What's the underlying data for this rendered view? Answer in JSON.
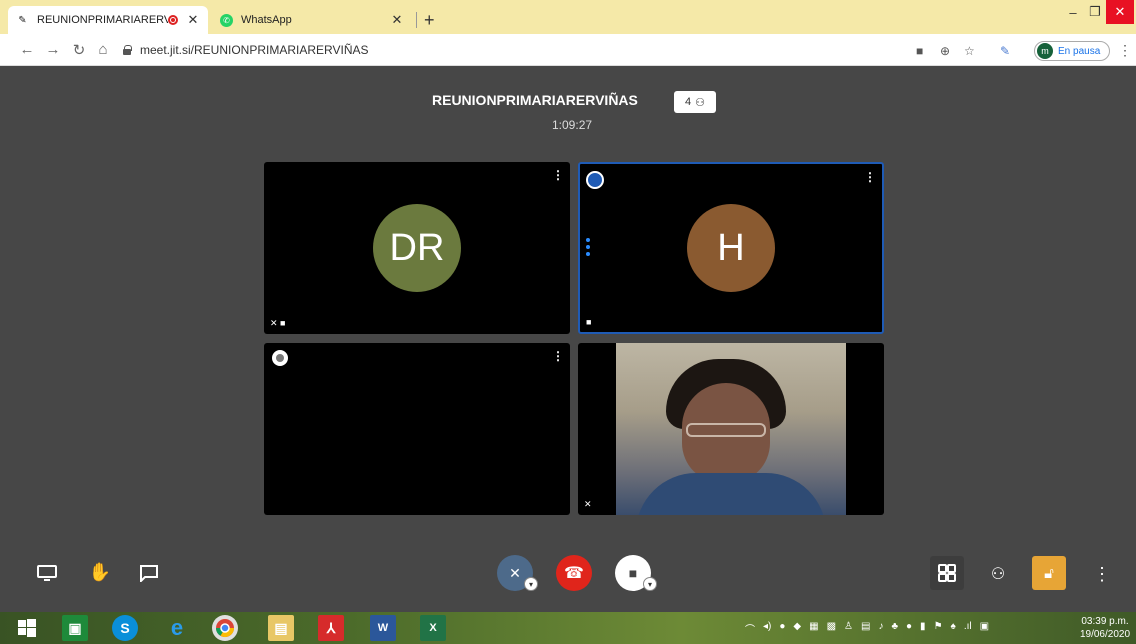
{
  "browser": {
    "tabs": [
      {
        "title": "REUNIONPRIMARIARERVIÑ/"
      },
      {
        "title": "WhatsApp"
      }
    ],
    "url": "meet.jit.si/REUNIONPRIMARIARERVIÑAS",
    "profile_initial": "m",
    "profile_status": "En pausa"
  },
  "meeting": {
    "title": "REUNIONPRIMARIARERVIÑAS",
    "participant_count": "4",
    "elapsed": "1:09:27"
  },
  "tiles": [
    {
      "initials": "DR",
      "color": "#6b7a3e"
    },
    {
      "initials": "H",
      "color": "#8a5a30"
    }
  ],
  "taskbar": {
    "time": "03:39 p.m.",
    "date": "19/06/2020"
  }
}
